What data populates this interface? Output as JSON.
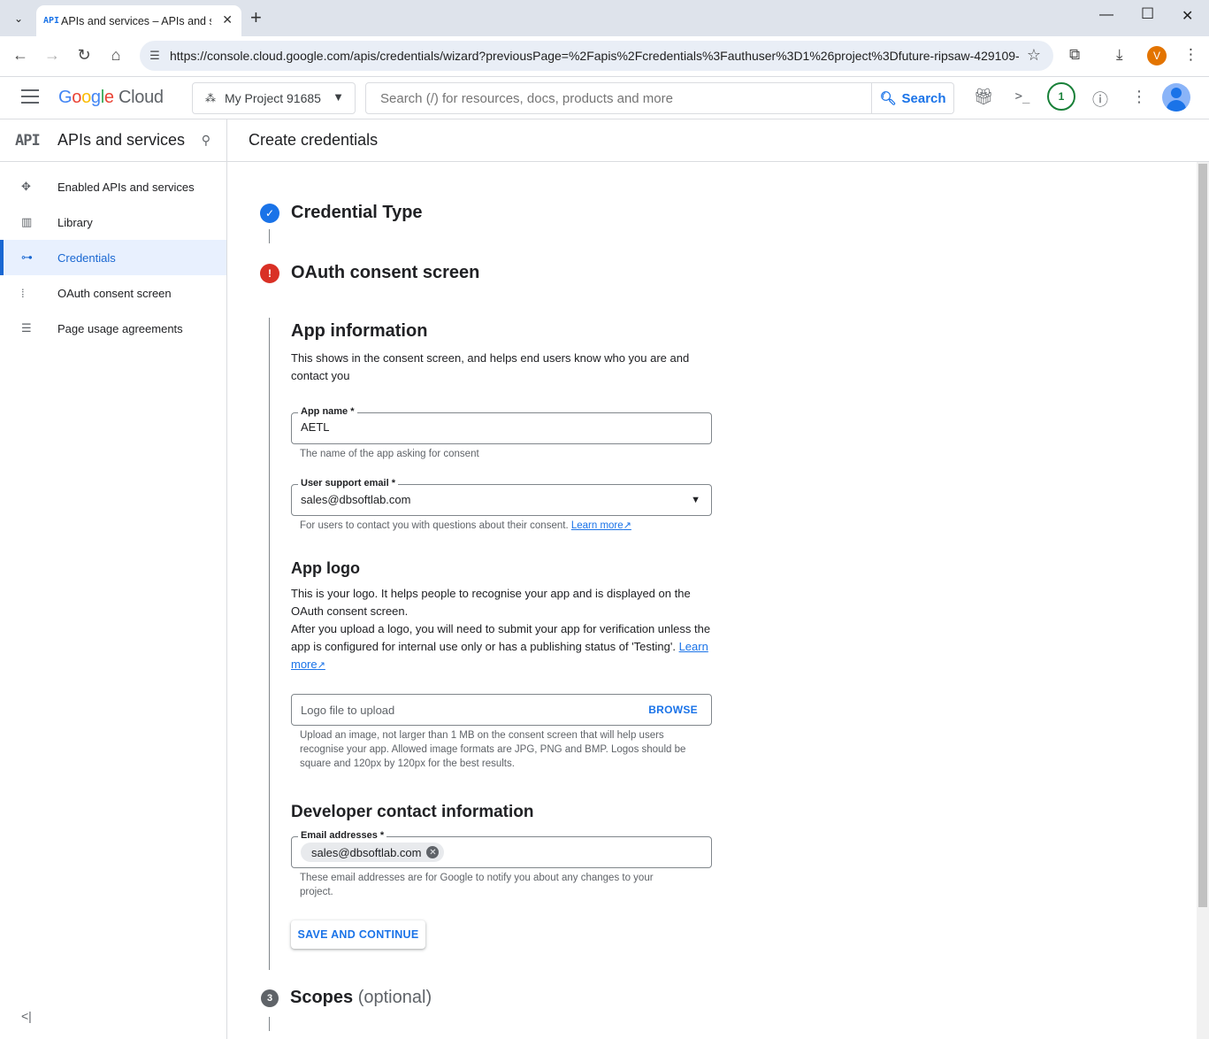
{
  "browser": {
    "tab_title": "APIs and services – APIs and services",
    "tab_favicon": "API",
    "url": "https://console.cloud.google.com/apis/credentials/wizard?previousPage=%2Fapis%2Fcredentials%3Fauthuser%3D1%26project%3Dfuture-ripsaw-429109-...",
    "profile_initial": "V"
  },
  "header": {
    "logo_google": [
      "G",
      "o",
      "o",
      "g",
      "l",
      "e"
    ],
    "logo_cloud": "Cloud",
    "project_name": "My Project 91685",
    "search_placeholder": "Search (/) for resources, docs, products and more",
    "search_button": "Search",
    "notification_count": "1"
  },
  "sidebar": {
    "api_badge": "API",
    "title": "APIs and services",
    "items": [
      {
        "label": "Enabled APIs and services",
        "icon": "enabled-apis-icon"
      },
      {
        "label": "Library",
        "icon": "library-icon"
      },
      {
        "label": "Credentials",
        "icon": "key-icon",
        "active": true
      },
      {
        "label": "OAuth consent screen",
        "icon": "consent-icon"
      },
      {
        "label": "Page usage agreements",
        "icon": "settings-list-icon"
      }
    ]
  },
  "main": {
    "page_title": "Create credentials",
    "steps": {
      "step1": "Credential Type",
      "step2": "OAuth consent screen",
      "step3_number": "3",
      "step3": "Scopes",
      "step3_optional": "(optional)"
    },
    "app_info": {
      "heading": "App information",
      "description": "This shows in the consent screen, and helps end users know who you are and contact you",
      "app_name_label": "App name *",
      "app_name_value": "AETL",
      "app_name_hint": "The name of the app asking for consent",
      "support_email_label": "User support email *",
      "support_email_value": "sales@dbsoftlab.com",
      "support_email_hint": "For users to contact you with questions about their consent.",
      "learn_more": "Learn more"
    },
    "app_logo": {
      "heading": "App logo",
      "description_1": "This is your logo. It helps people to recognise your app and is displayed on the OAuth consent screen.",
      "description_2": "After you upload a logo, you will need to submit your app for verification unless the app is configured for internal use only or has a publishing status of 'Testing'.",
      "learn_more": "Learn more",
      "upload_placeholder": "Logo file to upload",
      "browse_label": "BROWSE",
      "upload_hint": "Upload an image, not larger than 1 MB on the consent screen that will help users recognise your app. Allowed image formats are JPG, PNG and BMP. Logos should be square and 120px by 120px for the best results."
    },
    "developer_contact": {
      "heading": "Developer contact information",
      "email_label": "Email addresses *",
      "email_chip": "sales@dbsoftlab.com",
      "email_hint": "These email addresses are for Google to notify you about any changes to your project."
    },
    "save_button": "SAVE AND CONTINUE"
  },
  "colors": {
    "accent": "#1a73e8",
    "error": "#d93025",
    "step_done": "#1a73e8",
    "step_pending": "#5f6368"
  }
}
